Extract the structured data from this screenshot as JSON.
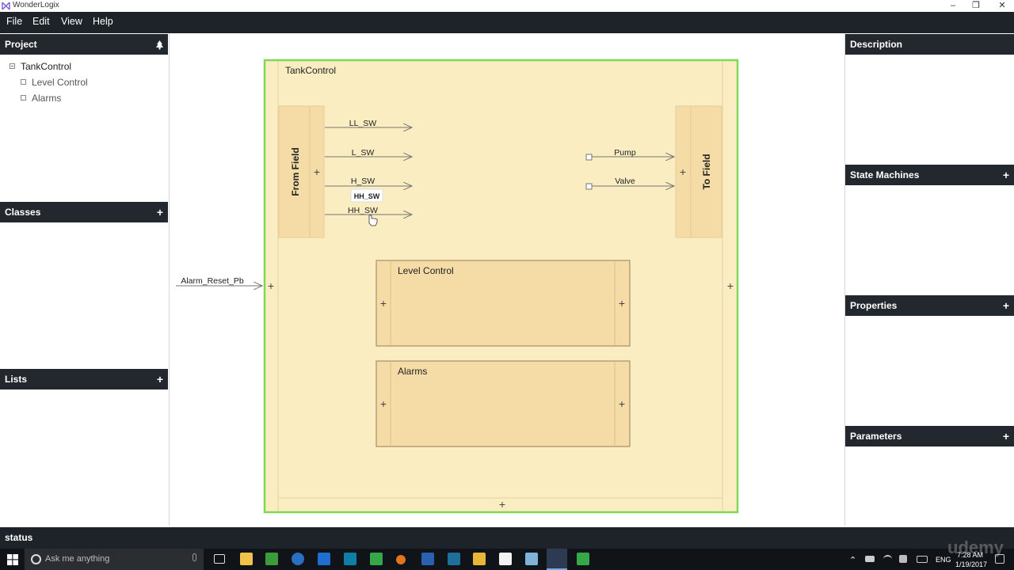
{
  "window": {
    "title": "WonderLogix"
  },
  "menu": {
    "items": [
      "File",
      "Edit",
      "View",
      "Help"
    ]
  },
  "project_panel": {
    "title": "Project",
    "icon": "tree-icon",
    "tree": {
      "root": "TankControl",
      "children": [
        "Level Control",
        "Alarms"
      ]
    }
  },
  "classes_panel": {
    "title": "Classes",
    "add_label": "+"
  },
  "lists_panel": {
    "title": "Lists",
    "add_label": "+"
  },
  "description_panel": {
    "title": "Description"
  },
  "state_machines_panel": {
    "title": "State Machines",
    "add_label": "+"
  },
  "properties_panel": {
    "title": "Properties",
    "add_label": "+"
  },
  "parameters_panel": {
    "title": "Parameters",
    "add_label": "+"
  },
  "diagram": {
    "block_title": "TankControl",
    "from_field_label": "From Field",
    "to_field_label": "To Field",
    "inputs": [
      "LL_SW",
      "L_SW",
      "H_SW",
      "HH_SW"
    ],
    "tooltip": "HH_SW",
    "outputs": [
      "Pump",
      "Valve"
    ],
    "external_input": "Alarm_Reset_Pb",
    "subblocks": [
      "Level Control",
      "Alarms"
    ],
    "plus": "+",
    "colors": {
      "block_fill": "#faedc2",
      "block_border": "#7ed957",
      "sub_fill": "#f5dca6",
      "sub_border": "#a88f66"
    }
  },
  "status": {
    "text": "status"
  },
  "taskbar": {
    "search_placeholder": "Ask me anything",
    "language": "ENG",
    "time": "7:28 AM",
    "date": "1/19/2017",
    "watermark": "udemy"
  }
}
